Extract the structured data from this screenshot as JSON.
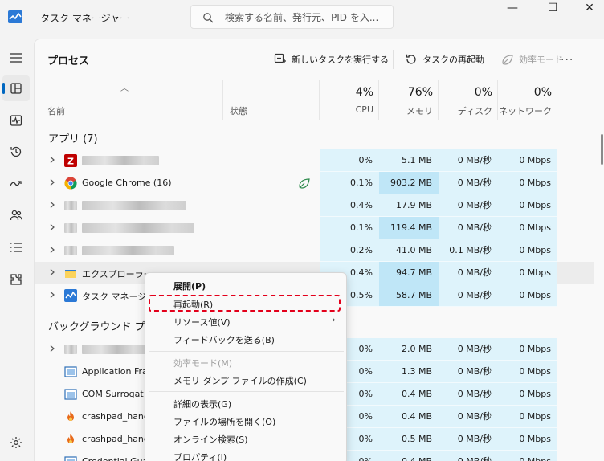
{
  "app": {
    "title": "タスク マネージャー"
  },
  "search": {
    "placeholder": "検索する名前、発行元、PID を入..."
  },
  "window": {
    "minimize": "—",
    "maximize": "☐",
    "close": "✕"
  },
  "sidebar": {
    "items": [
      {
        "icon": "hamburger-menu-icon"
      },
      {
        "icon": "processes-icon",
        "active": true
      },
      {
        "icon": "performance-icon"
      },
      {
        "icon": "app-history-icon"
      },
      {
        "icon": "startup-apps-icon"
      },
      {
        "icon": "users-icon"
      },
      {
        "icon": "details-icon"
      },
      {
        "icon": "services-icon"
      },
      {
        "icon": "settings-icon"
      }
    ]
  },
  "toolbar": {
    "title": "プロセス",
    "new_task": "新しいタスクを実行する",
    "restart_task": "タスクの再起動",
    "efficiency_mode": "効率モード",
    "more": "..."
  },
  "columns": {
    "name": "名前",
    "status": "状態",
    "cpu": {
      "pct": "4%",
      "label": "CPU"
    },
    "memory": {
      "pct": "76%",
      "label": "メモリ"
    },
    "disk": {
      "pct": "0%",
      "label": "ディスク"
    },
    "network": {
      "pct": "0%",
      "label": "ネットワーク"
    }
  },
  "groups": {
    "apps": "アプリ (7)",
    "background": "バックグラウンド プロ"
  },
  "apps": [
    {
      "name": "",
      "cpu": "0%",
      "mem": "5.1 MB",
      "disk": "0 MB/秒",
      "net": "0 Mbps"
    },
    {
      "name": "Google Chrome (16)",
      "cpu": "0.1%",
      "mem": "903.2 MB",
      "disk": "0 MB/秒",
      "net": "0 Mbps"
    },
    {
      "name": "",
      "cpu": "0.4%",
      "mem": "17.9 MB",
      "disk": "0 MB/秒",
      "net": "0 Mbps"
    },
    {
      "name": "",
      "cpu": "0.1%",
      "mem": "119.4 MB",
      "disk": "0 MB/秒",
      "net": "0 Mbps"
    },
    {
      "name": "",
      "cpu": "0.2%",
      "mem": "41.0 MB",
      "disk": "0.1 MB/秒",
      "net": "0 Mbps"
    },
    {
      "name": "エクスプローラー",
      "cpu": "0.4%",
      "mem": "94.7 MB",
      "disk": "0 MB/秒",
      "net": "0 Mbps"
    },
    {
      "name": "タスク マネージャ",
      "cpu": "0.5%",
      "mem": "58.7 MB",
      "disk": "0 MB/秒",
      "net": "0 Mbps"
    }
  ],
  "background": [
    {
      "name": "",
      "cpu": "0%",
      "mem": "2.0 MB",
      "disk": "0 MB/秒",
      "net": "0 Mbps"
    },
    {
      "name": "Application Fra",
      "cpu": "0%",
      "mem": "1.3 MB",
      "disk": "0 MB/秒",
      "net": "0 Mbps"
    },
    {
      "name": "COM Surrogat",
      "cpu": "0%",
      "mem": "0.4 MB",
      "disk": "0 MB/秒",
      "net": "0 Mbps"
    },
    {
      "name": "crashpad_hand",
      "cpu": "0%",
      "mem": "0.4 MB",
      "disk": "0 MB/秒",
      "net": "0 Mbps"
    },
    {
      "name": "crashpad_hand",
      "cpu": "0%",
      "mem": "0.5 MB",
      "disk": "0 MB/秒",
      "net": "0 Mbps"
    },
    {
      "name": "Credential Gua",
      "cpu": "0%",
      "mem": "0.4 MB",
      "disk": "0 MB/秒",
      "net": "0 Mbps"
    }
  ],
  "context_menu": {
    "expand": "展開(P)",
    "restart": "再起動(R)",
    "resource_values": "リソース値(V)",
    "feedback": "フィードバックを送る(B)",
    "efficiency": "効率モード(M)",
    "dump": "メモリ ダンプ ファイルの作成(C)",
    "details": "詳細の表示(G)",
    "open_location": "ファイルの場所を開く(O)",
    "search_online": "オンライン検索(S)",
    "properties": "プロパティ(I)"
  },
  "colors": {
    "accent": "#0067c0",
    "heat_light": "#def3fb",
    "heat_mid": "#bfe6f7",
    "highlight": "#e3001b"
  }
}
